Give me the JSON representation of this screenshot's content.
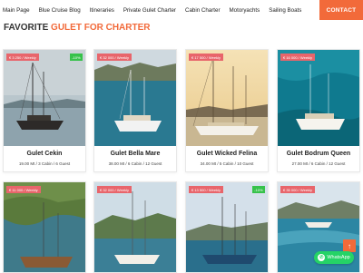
{
  "nav": {
    "items": [
      "Main Page",
      "Blue Cruise Blog",
      "Itineraries",
      "Private Gulet Charter",
      "Cabin Charter",
      "Motoryachts",
      "Sailing Boats"
    ],
    "contact_label": "CONTACT"
  },
  "heading": {
    "prefix": "FAVORITE",
    "accent": "GULET FOR CHARTER"
  },
  "colors": {
    "accent": "#f26a3a",
    "price_badge": "#e8656b",
    "discount_badge": "#36c24a",
    "whatsapp": "#25d366"
  },
  "cards": [
    {
      "price": "€ 3 250 / Weekly",
      "discount": "-10%",
      "name": "Gulet Cekin",
      "meta": "19.00 Mt / 3 Cabin / 6 Guest"
    },
    {
      "price": "€ 32 000 / Weekly",
      "discount": "",
      "name": "Gulet Bella Mare",
      "meta": "38.00 Mt / 6 Cabin / 12 Guest"
    },
    {
      "price": "€ 17 500 / Weekly",
      "discount": "",
      "name": "Gulet Wicked Felina",
      "meta": "34.00 Mt / 5 Cabin / 10 Guest"
    },
    {
      "price": "€ 16 000 / Weekly",
      "discount": "",
      "name": "Gulet Bodrum Queen",
      "meta": "27.00 Mt / 6 Cabin / 12 Guest"
    },
    {
      "price": "€ 11 000 / Weekly",
      "discount": "",
      "name": "",
      "meta": ""
    },
    {
      "price": "€ 32 000 / Weekly",
      "discount": "",
      "name": "",
      "meta": ""
    },
    {
      "price": "€ 13 500 / Weekly",
      "discount": "-10%",
      "name": "",
      "meta": ""
    },
    {
      "price": "€ 35 000 / Weekly",
      "discount": "",
      "name": "",
      "meta": ""
    }
  ],
  "whatsapp": {
    "label": "WhatsApp",
    "icon": "whatsapp-icon"
  },
  "back_to_top": {
    "icon": "arrow-up-icon"
  }
}
